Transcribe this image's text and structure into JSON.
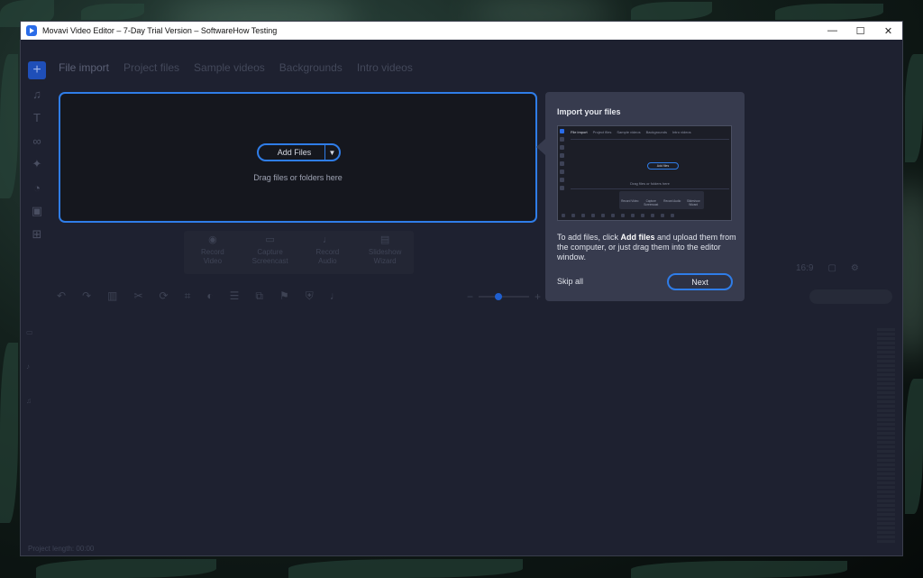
{
  "window": {
    "title": "Movavi Video Editor – 7-Day Trial Version – SoftwareHow Testing",
    "minimize": "—",
    "maximize": "☐",
    "close": "✕"
  },
  "tabs": [
    "File import",
    "Project files",
    "Sample videos",
    "Backgrounds",
    "Intro videos"
  ],
  "drop_zone": {
    "add_files_label": "Add Files",
    "drag_hint": "Drag files or folders here"
  },
  "record_actions": [
    {
      "line1": "Record",
      "line2": "Video"
    },
    {
      "line1": "Capture",
      "line2": "Screencast"
    },
    {
      "line1": "Record",
      "line2": "Audio"
    },
    {
      "line1": "Slideshow",
      "line2": "Wizard"
    }
  ],
  "preview": {
    "aspect_ratio": "16:9"
  },
  "footer": {
    "project_length": "Project length: 00:00"
  },
  "onboarding": {
    "title": "Import your files",
    "body_prefix": "To add files, click ",
    "body_bold": "Add files",
    "body_suffix": " and upload them from the computer, or just drag them into the editor window.",
    "skip_label": "Skip all",
    "next_label": "Next",
    "thumbnail": {
      "tabs": [
        "File import",
        "Project files",
        "Sample videos",
        "Backgrounds",
        "Intro videos"
      ],
      "add_files": "Add files",
      "drag_hint": "Drag files or folders here",
      "record_actions": [
        "Record Video",
        "Capture Screencast",
        "Record Audio",
        "Slideshow Wizard"
      ]
    }
  },
  "colors": {
    "accent": "#2f7de8",
    "window_bg": "#1e2130",
    "card_bg": "#373b4e"
  }
}
